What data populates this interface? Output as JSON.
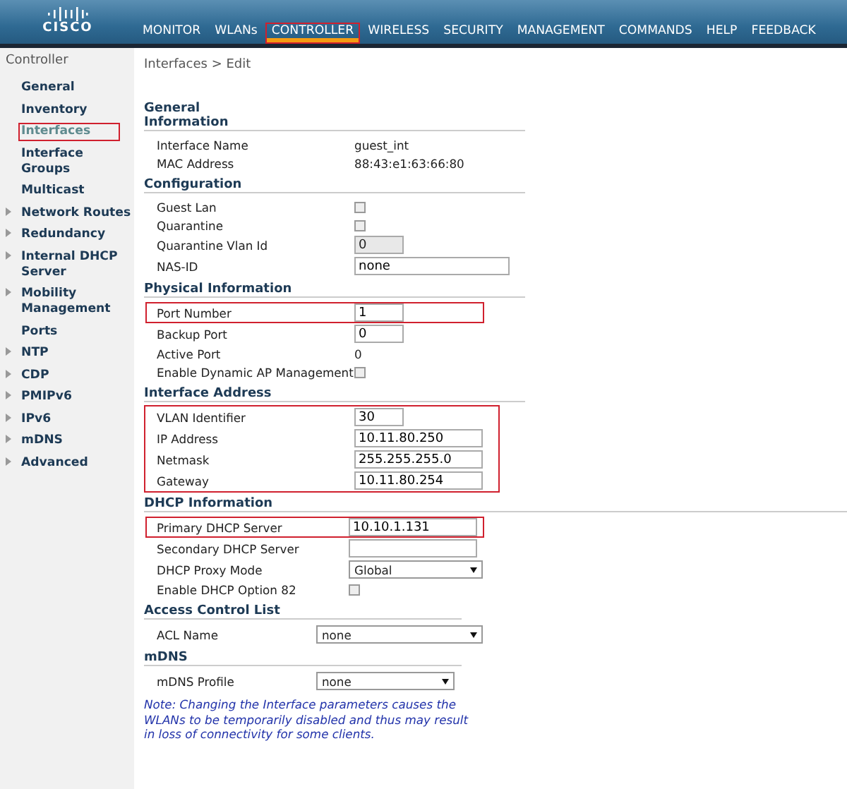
{
  "header": {
    "logo": "CISCO",
    "nav": [
      {
        "label": "MONITOR",
        "selected": false,
        "highlighted": false
      },
      {
        "label": "WLANs",
        "selected": false,
        "highlighted": false
      },
      {
        "label": "CONTROLLER",
        "selected": true,
        "highlighted": true
      },
      {
        "label": "WIRELESS",
        "selected": false,
        "highlighted": false
      },
      {
        "label": "SECURITY",
        "selected": false,
        "highlighted": false
      },
      {
        "label": "MANAGEMENT",
        "selected": false,
        "highlighted": false
      },
      {
        "label": "COMMANDS",
        "selected": false,
        "highlighted": false
      },
      {
        "label": "HELP",
        "selected": false,
        "highlighted": false
      },
      {
        "label": "FEEDBACK",
        "selected": false,
        "highlighted": false
      }
    ]
  },
  "sidebar": {
    "title": "Controller",
    "items": [
      {
        "label": "General",
        "expandable": false,
        "selected": false,
        "highlighted": false
      },
      {
        "label": "Inventory",
        "expandable": false,
        "selected": false,
        "highlighted": false
      },
      {
        "label": "Interfaces",
        "expandable": false,
        "selected": true,
        "highlighted": true
      },
      {
        "label": "Interface Groups",
        "expandable": false,
        "selected": false,
        "highlighted": false
      },
      {
        "label": "Multicast",
        "expandable": false,
        "selected": false,
        "highlighted": false
      },
      {
        "label": "Network Routes",
        "expandable": true,
        "selected": false,
        "highlighted": false
      },
      {
        "label": "Redundancy",
        "expandable": true,
        "selected": false,
        "highlighted": false
      },
      {
        "label": "Internal DHCP Server",
        "expandable": true,
        "selected": false,
        "highlighted": false
      },
      {
        "label": "Mobility Management",
        "expandable": true,
        "selected": false,
        "highlighted": false
      },
      {
        "label": "Ports",
        "expandable": false,
        "selected": false,
        "highlighted": false
      },
      {
        "label": "NTP",
        "expandable": true,
        "selected": false,
        "highlighted": false
      },
      {
        "label": "CDP",
        "expandable": true,
        "selected": false,
        "highlighted": false
      },
      {
        "label": "PMIPv6",
        "expandable": true,
        "selected": false,
        "highlighted": false
      },
      {
        "label": "IPv6",
        "expandable": true,
        "selected": false,
        "highlighted": false
      },
      {
        "label": "mDNS",
        "expandable": true,
        "selected": false,
        "highlighted": false
      },
      {
        "label": "Advanced",
        "expandable": true,
        "selected": false,
        "highlighted": false
      }
    ]
  },
  "breadcrumb": "Interfaces > Edit",
  "sections": [
    {
      "title": "General Information",
      "highlighted": false,
      "rows": [
        {
          "kind": "text",
          "label": "Interface Name",
          "value": "guest_int",
          "highlighted": false
        },
        {
          "kind": "text",
          "label": "MAC Address",
          "value": "88:43:e1:63:66:80",
          "highlighted": false
        }
      ]
    },
    {
      "title": "Configuration",
      "highlighted": false,
      "rows": [
        {
          "kind": "checkbox",
          "label": "Guest Lan",
          "checked": false,
          "highlighted": false
        },
        {
          "kind": "checkbox",
          "label": "Quarantine",
          "checked": false,
          "highlighted": false
        },
        {
          "kind": "short-input",
          "label": "Quarantine Vlan Id",
          "value": "0",
          "disabled": true,
          "highlighted": false
        },
        {
          "kind": "long-input",
          "label": "NAS-ID",
          "value": "none",
          "disabled": false,
          "highlighted": false
        }
      ]
    },
    {
      "title": "Physical Information",
      "highlighted": false,
      "rows": [
        {
          "kind": "short-input",
          "label": "Port Number",
          "value": "1",
          "disabled": false,
          "highlighted": true
        },
        {
          "kind": "short-input",
          "label": "Backup Port",
          "value": "0",
          "disabled": false,
          "highlighted": false
        },
        {
          "kind": "text",
          "label": "Active Port",
          "value": "0",
          "highlighted": false
        },
        {
          "kind": "checkbox",
          "label": "Enable Dynamic AP Management",
          "checked": false,
          "highlighted": false
        }
      ]
    },
    {
      "title": "Interface Address",
      "highlighted": true,
      "rows": [
        {
          "kind": "short-input",
          "label": "VLAN Identifier",
          "value": "30",
          "disabled": false,
          "highlighted": false
        },
        {
          "kind": "input",
          "label": "IP Address",
          "value": "10.11.80.250",
          "disabled": false,
          "highlighted": false
        },
        {
          "kind": "input",
          "label": "Netmask",
          "value": "255.255.255.0",
          "disabled": false,
          "highlighted": false
        },
        {
          "kind": "input",
          "label": "Gateway",
          "value": "10.11.80.254",
          "disabled": false,
          "highlighted": false
        }
      ]
    },
    {
      "title": "DHCP Information",
      "highlighted": false,
      "rows": [
        {
          "kind": "input",
          "label": "Primary DHCP Server",
          "value": "10.10.1.131",
          "disabled": false,
          "highlighted": true
        },
        {
          "kind": "input",
          "label": "Secondary DHCP Server",
          "value": "",
          "disabled": false,
          "highlighted": false
        },
        {
          "kind": "select",
          "label": "DHCP Proxy Mode",
          "value": "Global",
          "highlighted": false
        },
        {
          "kind": "checkbox",
          "label": "Enable DHCP Option 82",
          "checked": false,
          "highlighted": false
        }
      ]
    },
    {
      "title": "Access Control List",
      "highlighted": false,
      "rows": [
        {
          "kind": "select",
          "label": "ACL Name",
          "value": "none",
          "highlighted": false
        }
      ]
    },
    {
      "title": "mDNS",
      "highlighted": false,
      "rows": [
        {
          "kind": "long-select",
          "label": "mDNS Profile",
          "value": "none",
          "highlighted": false
        }
      ]
    }
  ],
  "note": "Note: Changing the Interface parameters causes the WLANs to be temporarily disabled and thus may result in loss of connectivity for some clients."
}
